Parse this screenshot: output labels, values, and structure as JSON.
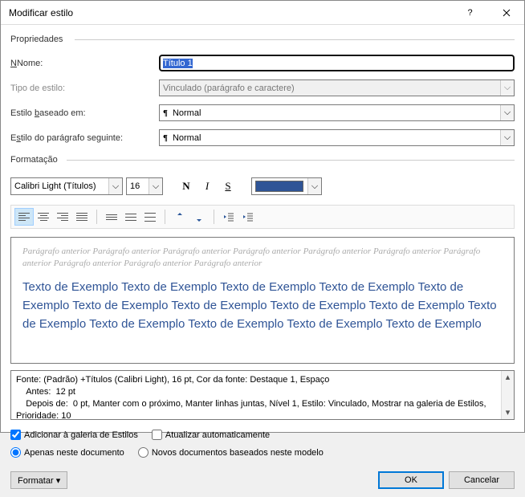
{
  "title": "Modificar estilo",
  "sections": {
    "props": "Propriedades",
    "format": "Formatação"
  },
  "labels": {
    "name": "Nome:",
    "type": "Tipo de estilo:",
    "based": "Estilo baseado em:",
    "following": "Estilo do parágrafo seguinte:"
  },
  "values": {
    "name": "Título 1",
    "type": "Vinculado (parágrafo e caractere)",
    "based": "Normal",
    "following": "Normal",
    "font": "Calibri Light (Títulos)",
    "size": "16"
  },
  "btns": {
    "bold": "N",
    "italic": "I",
    "underline": "S"
  },
  "preview": {
    "prev": "Parágrafo anterior Parágrafo anterior Parágrafo anterior Parágrafo anterior Parágrafo anterior Parágrafo anterior Parágrafo anterior Parágrafo anterior Parágrafo anterior Parágrafo anterior",
    "main": "Texto de Exemplo Texto de Exemplo Texto de Exemplo Texto de Exemplo Texto de Exemplo Texto de Exemplo Texto de Exemplo Texto de Exemplo Texto de Exemplo Texto de Exemplo Texto de Exemplo Texto de Exemplo Texto de Exemplo Texto de Exemplo"
  },
  "desc": {
    "line1": "Fonte: (Padrão) +Títulos (Calibri Light), 16 pt, Cor da fonte: Destaque 1, Espaço",
    "line2": "    Antes:  12 pt",
    "line3": "    Depois de:  0 pt, Manter com o próximo, Manter linhas juntas, Nível 1, Estilo: Vinculado, Mostrar na galeria de Estilos, Prioridade: 10"
  },
  "opts": {
    "gallery": "Adicionar à galeria de Estilos",
    "auto": "Atualizar automaticamente",
    "thisdoc": "Apenas neste documento",
    "template": "Novos documentos baseados neste modelo"
  },
  "footer": {
    "format": "Formatar",
    "ok": "OK",
    "cancel": "Cancelar"
  },
  "colors": {
    "accent": "#2f5496"
  }
}
